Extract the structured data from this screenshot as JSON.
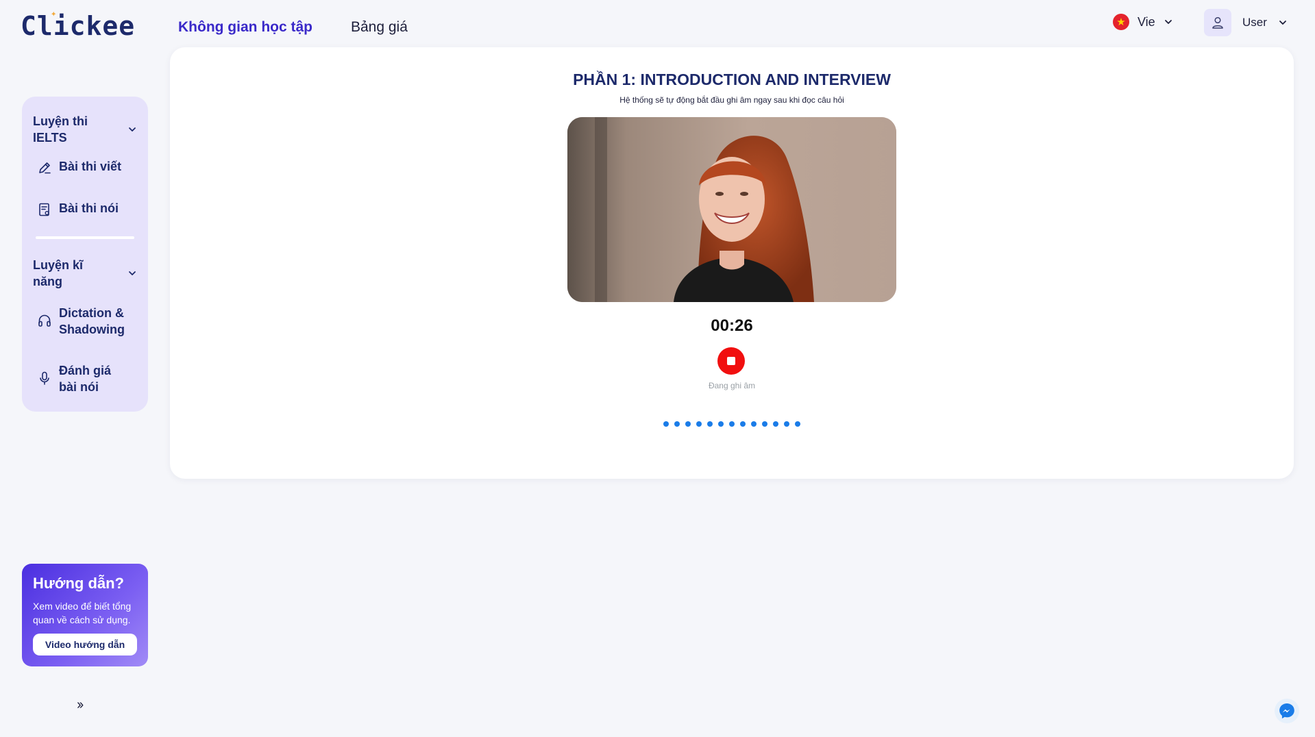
{
  "header": {
    "logo": "Clickee",
    "nav": [
      {
        "label": "Không gian học tập",
        "active": true
      },
      {
        "label": "Bảng giá",
        "active": false
      }
    ],
    "language": {
      "label": "Vie",
      "flag_color": "#e4232c"
    },
    "user": {
      "label": "User"
    }
  },
  "sidebar": {
    "sections": [
      {
        "title": "Luyện thi IELTS",
        "items": [
          {
            "label": "Bài thi viết",
            "icon": "pencil-icon"
          },
          {
            "label": "Bài thi nói",
            "icon": "speaking-test-icon"
          }
        ]
      },
      {
        "title": "Luyện kĩ năng",
        "items": [
          {
            "label": "Dictation & Shadowing",
            "icon": "headphones-icon"
          },
          {
            "label": "Đánh giá bài nói",
            "icon": "microphone-icon"
          }
        ]
      }
    ]
  },
  "guide": {
    "title": "Hướng dẫn?",
    "description": "Xem video để biết tổng quan về cách sử dụng.",
    "button_label": "Video hướng dẫn"
  },
  "collapse_label": "››",
  "main": {
    "title": "PHẦN 1: INTRODUCTION AND INTERVIEW",
    "subtitle": "Hệ thống sẽ tự động bắt đầu ghi âm ngay sau khi đọc câu hỏi",
    "timer": "00:26",
    "recording_label": "Đang ghi âm",
    "progress_dots": 13,
    "accent_color": "#1a7ce8",
    "record_color": "#f10f0f"
  },
  "colors": {
    "brand": "#3a29c9",
    "navy": "#1d2a6b",
    "sidebar_bg": "#e6e2fb",
    "page_bg": "#f5f6fa"
  }
}
